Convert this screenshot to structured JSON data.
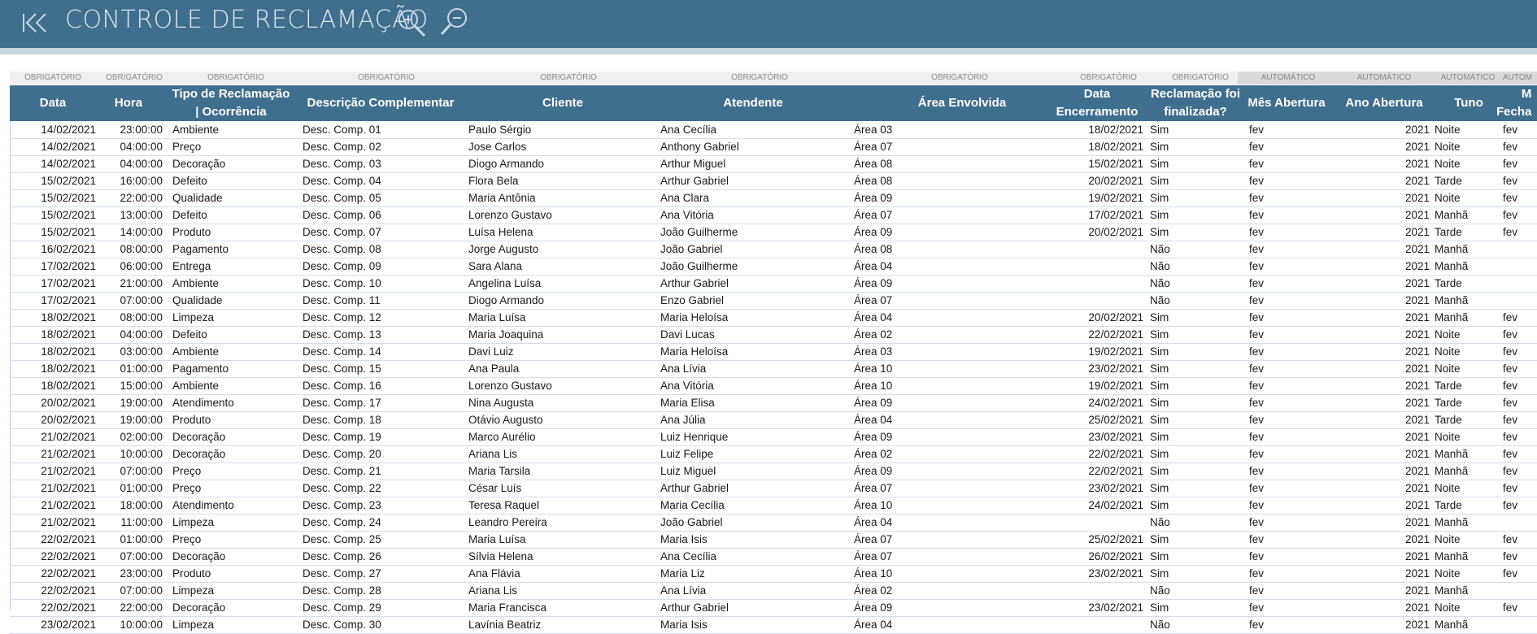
{
  "app": {
    "title": "CONTROLE DE RECLAMAÇÃO",
    "icons": [
      "first-page-icon",
      "zoom-in-icon",
      "zoom-out-icon"
    ],
    "colors": {
      "header_blue": "#3f6f8f",
      "requirement_gray": "#efefef",
      "automatic_gray": "#d9d9d9"
    }
  },
  "table": {
    "columns": [
      {
        "requirement": "OBRIGATÓRIO",
        "header": "Data"
      },
      {
        "requirement": "OBRIGATÓRIO",
        "header": "Hora"
      },
      {
        "requirement": "OBRIGATÓRIO",
        "header": "Tipo de Reclamação\n| Ocorrência"
      },
      {
        "requirement": "OBRIGATÓRIO",
        "header": "Descrição Complementar"
      },
      {
        "requirement": "OBRIGATÓRIO",
        "header": "Cliente"
      },
      {
        "requirement": "OBRIGATÓRIO",
        "header": "Atendente"
      },
      {
        "requirement": "OBRIGATÓRIO",
        "header": "Área Envolvida"
      },
      {
        "requirement": "OBRIGATÓRIO",
        "header": "Data\nEncerramento"
      },
      {
        "requirement": "OBRIGATÓRIO",
        "header": "Reclamação foi\nfinalizada?"
      },
      {
        "requirement": "AUTOMÁTICO",
        "header": "Mês Abertura"
      },
      {
        "requirement": "AUTOMÁTICO",
        "header": "Ano Abertura"
      },
      {
        "requirement": "AUTOMÁTICO",
        "header": "Tuno"
      },
      {
        "requirement": "AUTOM",
        "header": "M\nFecha"
      }
    ],
    "rows": [
      [
        "14/02/2021",
        "23:00:00",
        "Ambiente",
        "Desc. Comp. 01",
        "Paulo Sérgio",
        "Ana Cecília",
        "Área 03",
        "18/02/2021",
        "Sim",
        "fev",
        "2021",
        "Noite",
        "fev"
      ],
      [
        "14/02/2021",
        "04:00:00",
        "Preço",
        "Desc. Comp. 02",
        "Jose Carlos",
        "Anthony Gabriel",
        "Área 07",
        "18/02/2021",
        "Sim",
        "fev",
        "2021",
        "Noite",
        "fev"
      ],
      [
        "14/02/2021",
        "04:00:00",
        "Decoração",
        "Desc. Comp. 03",
        "Diogo Armando",
        "Arthur Miguel",
        "Área 08",
        "15/02/2021",
        "Sim",
        "fev",
        "2021",
        "Noite",
        "fev"
      ],
      [
        "15/02/2021",
        "16:00:00",
        "Defeito",
        "Desc. Comp. 04",
        "Flora Bela",
        "Arthur Gabriel",
        "Área 08",
        "20/02/2021",
        "Sim",
        "fev",
        "2021",
        "Tarde",
        "fev"
      ],
      [
        "15/02/2021",
        "22:00:00",
        "Qualidade",
        "Desc. Comp. 05",
        "Maria Antônia",
        "Ana Clara",
        "Área 09",
        "19/02/2021",
        "Sim",
        "fev",
        "2021",
        "Noite",
        "fev"
      ],
      [
        "15/02/2021",
        "13:00:00",
        "Defeito",
        "Desc. Comp. 06",
        "Lorenzo Gustavo",
        "Ana Vitória",
        "Área 07",
        "17/02/2021",
        "Sim",
        "fev",
        "2021",
        "Manhã",
        "fev"
      ],
      [
        "15/02/2021",
        "14:00:00",
        "Produto",
        "Desc. Comp. 07",
        "Luísa Helena",
        "João Guilherme",
        "Área 09",
        "20/02/2021",
        "Sim",
        "fev",
        "2021",
        "Tarde",
        "fev"
      ],
      [
        "16/02/2021",
        "08:00:00",
        "Pagamento",
        "Desc. Comp. 08",
        "Jorge Augusto",
        "João Gabriel",
        "Área 08",
        "",
        "Não",
        "fev",
        "2021",
        "Manhã",
        ""
      ],
      [
        "17/02/2021",
        "06:00:00",
        "Entrega",
        "Desc. Comp. 09",
        "Sara Alana",
        "João Guilherme",
        "Área 04",
        "",
        "Não",
        "fev",
        "2021",
        "Manhã",
        ""
      ],
      [
        "17/02/2021",
        "21:00:00",
        "Ambiente",
        "Desc. Comp. 10",
        "Angelina Luísa",
        "Arthur Gabriel",
        "Área 09",
        "",
        "Não",
        "fev",
        "2021",
        "Tarde",
        ""
      ],
      [
        "17/02/2021",
        "07:00:00",
        "Qualidade",
        "Desc. Comp. 11",
        "Diogo Armando",
        "Enzo Gabriel",
        "Área 07",
        "",
        "Não",
        "fev",
        "2021",
        "Manhã",
        ""
      ],
      [
        "18/02/2021",
        "08:00:00",
        "Limpeza",
        "Desc. Comp. 12",
        "Maria Luísa",
        "Maria Heloísa",
        "Área 04",
        "20/02/2021",
        "Sim",
        "fev",
        "2021",
        "Manhã",
        "fev"
      ],
      [
        "18/02/2021",
        "04:00:00",
        "Defeito",
        "Desc. Comp. 13",
        "Maria Joaquina",
        "Davi Lucas",
        "Área 02",
        "22/02/2021",
        "Sim",
        "fev",
        "2021",
        "Noite",
        "fev"
      ],
      [
        "18/02/2021",
        "03:00:00",
        "Ambiente",
        "Desc. Comp. 14",
        "Davi Luiz",
        "Maria Heloísa",
        "Área 03",
        "19/02/2021",
        "Sim",
        "fev",
        "2021",
        "Noite",
        "fev"
      ],
      [
        "18/02/2021",
        "01:00:00",
        "Pagamento",
        "Desc. Comp. 15",
        "Ana Paula",
        "Ana Lívia",
        "Área 10",
        "23/02/2021",
        "Sim",
        "fev",
        "2021",
        "Noite",
        "fev"
      ],
      [
        "18/02/2021",
        "15:00:00",
        "Ambiente",
        "Desc. Comp. 16",
        "Lorenzo Gustavo",
        "Ana Vitória",
        "Área 10",
        "19/02/2021",
        "Sim",
        "fev",
        "2021",
        "Tarde",
        "fev"
      ],
      [
        "20/02/2021",
        "19:00:00",
        "Atendimento",
        "Desc. Comp. 17",
        "Nina Augusta",
        "Maria Elisa",
        "Área 09",
        "24/02/2021",
        "Sim",
        "fev",
        "2021",
        "Tarde",
        "fev"
      ],
      [
        "20/02/2021",
        "19:00:00",
        "Produto",
        "Desc. Comp. 18",
        "Otávio Augusto",
        "Ana Júlia",
        "Área 04",
        "25/02/2021",
        "Sim",
        "fev",
        "2021",
        "Tarde",
        "fev"
      ],
      [
        "21/02/2021",
        "02:00:00",
        "Decoração",
        "Desc. Comp. 19",
        "Marco Aurélio",
        "Luiz Henrique",
        "Área 09",
        "23/02/2021",
        "Sim",
        "fev",
        "2021",
        "Noite",
        "fev"
      ],
      [
        "21/02/2021",
        "10:00:00",
        "Decoração",
        "Desc. Comp. 20",
        "Ariana Lis",
        "Luiz Felipe",
        "Área 02",
        "22/02/2021",
        "Sim",
        "fev",
        "2021",
        "Manhã",
        "fev"
      ],
      [
        "21/02/2021",
        "07:00:00",
        "Preço",
        "Desc. Comp. 21",
        "Maria Tarsila",
        "Luiz Miguel",
        "Área 09",
        "22/02/2021",
        "Sim",
        "fev",
        "2021",
        "Manhã",
        "fev"
      ],
      [
        "21/02/2021",
        "01:00:00",
        "Preço",
        "Desc. Comp. 22",
        "César Luís",
        "Arthur Gabriel",
        "Área 07",
        "23/02/2021",
        "Sim",
        "fev",
        "2021",
        "Noite",
        "fev"
      ],
      [
        "21/02/2021",
        "18:00:00",
        "Atendimento",
        "Desc. Comp. 23",
        "Teresa Raquel",
        "Maria Cecília",
        "Área 10",
        "24/02/2021",
        "Sim",
        "fev",
        "2021",
        "Tarde",
        "fev"
      ],
      [
        "21/02/2021",
        "11:00:00",
        "Limpeza",
        "Desc. Comp. 24",
        "Leandro Pereira",
        "João Gabriel",
        "Área 04",
        "",
        "Não",
        "fev",
        "2021",
        "Manhã",
        ""
      ],
      [
        "22/02/2021",
        "01:00:00",
        "Preço",
        "Desc. Comp. 25",
        "Maria Luísa",
        "Maria Isis",
        "Área 07",
        "25/02/2021",
        "Sim",
        "fev",
        "2021",
        "Noite",
        "fev"
      ],
      [
        "22/02/2021",
        "07:00:00",
        "Decoração",
        "Desc. Comp. 26",
        "Sílvia Helena",
        "Ana Cecília",
        "Área 07",
        "26/02/2021",
        "Sim",
        "fev",
        "2021",
        "Manhã",
        "fev"
      ],
      [
        "22/02/2021",
        "23:00:00",
        "Produto",
        "Desc. Comp. 27",
        "Ana Flávia",
        "Maria Liz",
        "Área 10",
        "23/02/2021",
        "Sim",
        "fev",
        "2021",
        "Noite",
        "fev"
      ],
      [
        "22/02/2021",
        "07:00:00",
        "Limpeza",
        "Desc. Comp. 28",
        "Ariana Lis",
        "Ana Lívia",
        "Área 02",
        "",
        "Não",
        "fev",
        "2021",
        "Manhã",
        ""
      ],
      [
        "22/02/2021",
        "22:00:00",
        "Decoração",
        "Desc. Comp. 29",
        "Maria Francisca",
        "Arthur Gabriel",
        "Área 09",
        "23/02/2021",
        "Sim",
        "fev",
        "2021",
        "Noite",
        "fev"
      ],
      [
        "23/02/2021",
        "10:00:00",
        "Limpeza",
        "Desc. Comp. 30",
        "Lavínia Beatriz",
        "Maria Isis",
        "Área 04",
        "",
        "Não",
        "fev",
        "2021",
        "Manhã",
        ""
      ]
    ]
  }
}
